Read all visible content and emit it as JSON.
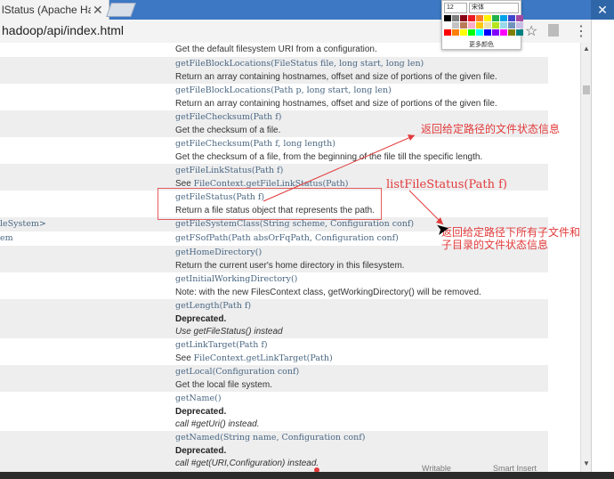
{
  "browser": {
    "tab_title": "lStatus (Apache Had",
    "tab_close": "✕",
    "url": "hadoop/api/index.html",
    "star_icon": "star-icon",
    "menu_icon": "⋮",
    "window_close": "✕"
  },
  "palette": {
    "font_size": "12",
    "font_name": "宋体",
    "more_colors": "更多颜色",
    "colors": [
      "#000000",
      "#7f7f7f",
      "#880015",
      "#ed1c24",
      "#ff7f27",
      "#fff200",
      "#22b14c",
      "#00a2e8",
      "#3f48cc",
      "#a349a4",
      "#ffffff",
      "#c3c3c3",
      "#b97a57",
      "#ffaec9",
      "#ffc90e",
      "#efe4b0",
      "#b5e61d",
      "#99d9ea",
      "#7092be",
      "#c8bfe7",
      "#ff0000",
      "#ff8000",
      "#ffff00",
      "#00ff00",
      "#00ffff",
      "#0000ff",
      "#8000ff",
      "#ff00ff",
      "#808000",
      "#008080"
    ]
  },
  "rows": [
    {
      "desc": "Get the default filesystem URI from a configuration."
    },
    {
      "method": "getFileBlockLocations",
      "params": "(FileStatus  file,  long  start,  long  len)",
      "desc": "Return an array containing hostnames, offset and size of portions of the given file."
    },
    {
      "method": "getFileBlockLocations",
      "params": "(Path  p,  long  start,  long  len)",
      "desc": "Return an array containing hostnames, offset and size of portions of the given file."
    },
    {
      "method": "getFileChecksum",
      "params": "(Path  f)",
      "desc": "Get the checksum of a file."
    },
    {
      "method": "getFileChecksum",
      "params": "(Path  f,  long  length)",
      "desc": "Get the checksum of a file, from the beginning of the file till the specific length."
    },
    {
      "method": "getFileLinkStatus",
      "params": "(Path  f)",
      "desc_pre": "See ",
      "desc_code": "FileContext.getFileLinkStatus(Path)"
    },
    {
      "method": "getFileStatus",
      "params": "(Path  f)",
      "desc": "Return a file status object that represents the path."
    },
    {
      "left": "leSystem>",
      "method": "getFileSystemClass",
      "params": "(String  scheme,  Configuration  conf)"
    },
    {
      "left": "em",
      "method": "getFSofPath",
      "params": "(Path  absOrFqPath,  Configuration  conf)"
    },
    {
      "method": "getHomeDirectory",
      "params": "()",
      "desc": "Return the current user's home directory in this filesystem."
    },
    {
      "method": "getInitialWorkingDirectory",
      "params": "()",
      "desc": "Note: with the new FilesContext class, getWorkingDirectory() will be removed."
    },
    {
      "method": "getLength",
      "params": "(Path  f)",
      "desc_bold": "Deprecated.",
      "desc_ital": "Use getFileStatus() instead"
    },
    {
      "method": "getLinkTarget",
      "params": "(Path  f)",
      "desc_pre": "See ",
      "desc_code": "FileContext.getLinkTarget(Path)"
    },
    {
      "method": "getLocal",
      "params": "(Configuration  conf)",
      "desc": "Get the local file system."
    },
    {
      "method": "getName",
      "params": "()",
      "desc_bold": "Deprecated.",
      "desc_ital": "call #getUri() instead."
    },
    {
      "method": "getNamed",
      "params": "(String  name,  Configuration  conf)",
      "desc_bold": "Deprecated.",
      "desc_ital": "call #get(URI,Configuration) instead."
    }
  ],
  "annotations": {
    "note1": "返回给定路径的文件状态信息",
    "note2": "listFileStatus(Path f)",
    "note3a": "返回给定路径下所有子文件和",
    "note3b": "子目录的文件状态信息"
  },
  "statusbar": {
    "left": "Writable",
    "right": "Smart Insert"
  }
}
